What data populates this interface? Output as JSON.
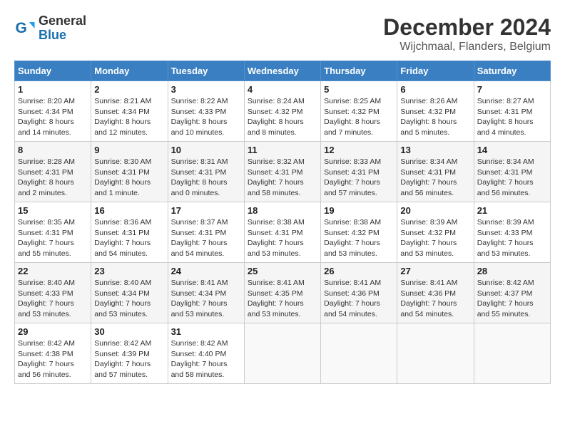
{
  "logo": {
    "line1": "General",
    "line2": "Blue"
  },
  "header": {
    "month": "December 2024",
    "location": "Wijchmaal, Flanders, Belgium"
  },
  "weekdays": [
    "Sunday",
    "Monday",
    "Tuesday",
    "Wednesday",
    "Thursday",
    "Friday",
    "Saturday"
  ],
  "weeks": [
    [
      {
        "day": "1",
        "sunrise": "Sunrise: 8:20 AM",
        "sunset": "Sunset: 4:34 PM",
        "daylight": "Daylight: 8 hours and 14 minutes."
      },
      {
        "day": "2",
        "sunrise": "Sunrise: 8:21 AM",
        "sunset": "Sunset: 4:34 PM",
        "daylight": "Daylight: 8 hours and 12 minutes."
      },
      {
        "day": "3",
        "sunrise": "Sunrise: 8:22 AM",
        "sunset": "Sunset: 4:33 PM",
        "daylight": "Daylight: 8 hours and 10 minutes."
      },
      {
        "day": "4",
        "sunrise": "Sunrise: 8:24 AM",
        "sunset": "Sunset: 4:32 PM",
        "daylight": "Daylight: 8 hours and 8 minutes."
      },
      {
        "day": "5",
        "sunrise": "Sunrise: 8:25 AM",
        "sunset": "Sunset: 4:32 PM",
        "daylight": "Daylight: 8 hours and 7 minutes."
      },
      {
        "day": "6",
        "sunrise": "Sunrise: 8:26 AM",
        "sunset": "Sunset: 4:32 PM",
        "daylight": "Daylight: 8 hours and 5 minutes."
      },
      {
        "day": "7",
        "sunrise": "Sunrise: 8:27 AM",
        "sunset": "Sunset: 4:31 PM",
        "daylight": "Daylight: 8 hours and 4 minutes."
      }
    ],
    [
      {
        "day": "8",
        "sunrise": "Sunrise: 8:28 AM",
        "sunset": "Sunset: 4:31 PM",
        "daylight": "Daylight: 8 hours and 2 minutes."
      },
      {
        "day": "9",
        "sunrise": "Sunrise: 8:30 AM",
        "sunset": "Sunset: 4:31 PM",
        "daylight": "Daylight: 8 hours and 1 minute."
      },
      {
        "day": "10",
        "sunrise": "Sunrise: 8:31 AM",
        "sunset": "Sunset: 4:31 PM",
        "daylight": "Daylight: 8 hours and 0 minutes."
      },
      {
        "day": "11",
        "sunrise": "Sunrise: 8:32 AM",
        "sunset": "Sunset: 4:31 PM",
        "daylight": "Daylight: 7 hours and 58 minutes."
      },
      {
        "day": "12",
        "sunrise": "Sunrise: 8:33 AM",
        "sunset": "Sunset: 4:31 PM",
        "daylight": "Daylight: 7 hours and 57 minutes."
      },
      {
        "day": "13",
        "sunrise": "Sunrise: 8:34 AM",
        "sunset": "Sunset: 4:31 PM",
        "daylight": "Daylight: 7 hours and 56 minutes."
      },
      {
        "day": "14",
        "sunrise": "Sunrise: 8:34 AM",
        "sunset": "Sunset: 4:31 PM",
        "daylight": "Daylight: 7 hours and 56 minutes."
      }
    ],
    [
      {
        "day": "15",
        "sunrise": "Sunrise: 8:35 AM",
        "sunset": "Sunset: 4:31 PM",
        "daylight": "Daylight: 7 hours and 55 minutes."
      },
      {
        "day": "16",
        "sunrise": "Sunrise: 8:36 AM",
        "sunset": "Sunset: 4:31 PM",
        "daylight": "Daylight: 7 hours and 54 minutes."
      },
      {
        "day": "17",
        "sunrise": "Sunrise: 8:37 AM",
        "sunset": "Sunset: 4:31 PM",
        "daylight": "Daylight: 7 hours and 54 minutes."
      },
      {
        "day": "18",
        "sunrise": "Sunrise: 8:38 AM",
        "sunset": "Sunset: 4:31 PM",
        "daylight": "Daylight: 7 hours and 53 minutes."
      },
      {
        "day": "19",
        "sunrise": "Sunrise: 8:38 AM",
        "sunset": "Sunset: 4:32 PM",
        "daylight": "Daylight: 7 hours and 53 minutes."
      },
      {
        "day": "20",
        "sunrise": "Sunrise: 8:39 AM",
        "sunset": "Sunset: 4:32 PM",
        "daylight": "Daylight: 7 hours and 53 minutes."
      },
      {
        "day": "21",
        "sunrise": "Sunrise: 8:39 AM",
        "sunset": "Sunset: 4:33 PM",
        "daylight": "Daylight: 7 hours and 53 minutes."
      }
    ],
    [
      {
        "day": "22",
        "sunrise": "Sunrise: 8:40 AM",
        "sunset": "Sunset: 4:33 PM",
        "daylight": "Daylight: 7 hours and 53 minutes."
      },
      {
        "day": "23",
        "sunrise": "Sunrise: 8:40 AM",
        "sunset": "Sunset: 4:34 PM",
        "daylight": "Daylight: 7 hours and 53 minutes."
      },
      {
        "day": "24",
        "sunrise": "Sunrise: 8:41 AM",
        "sunset": "Sunset: 4:34 PM",
        "daylight": "Daylight: 7 hours and 53 minutes."
      },
      {
        "day": "25",
        "sunrise": "Sunrise: 8:41 AM",
        "sunset": "Sunset: 4:35 PM",
        "daylight": "Daylight: 7 hours and 53 minutes."
      },
      {
        "day": "26",
        "sunrise": "Sunrise: 8:41 AM",
        "sunset": "Sunset: 4:36 PM",
        "daylight": "Daylight: 7 hours and 54 minutes."
      },
      {
        "day": "27",
        "sunrise": "Sunrise: 8:41 AM",
        "sunset": "Sunset: 4:36 PM",
        "daylight": "Daylight: 7 hours and 54 minutes."
      },
      {
        "day": "28",
        "sunrise": "Sunrise: 8:42 AM",
        "sunset": "Sunset: 4:37 PM",
        "daylight": "Daylight: 7 hours and 55 minutes."
      }
    ],
    [
      {
        "day": "29",
        "sunrise": "Sunrise: 8:42 AM",
        "sunset": "Sunset: 4:38 PM",
        "daylight": "Daylight: 7 hours and 56 minutes."
      },
      {
        "day": "30",
        "sunrise": "Sunrise: 8:42 AM",
        "sunset": "Sunset: 4:39 PM",
        "daylight": "Daylight: 7 hours and 57 minutes."
      },
      {
        "day": "31",
        "sunrise": "Sunrise: 8:42 AM",
        "sunset": "Sunset: 4:40 PM",
        "daylight": "Daylight: 7 hours and 58 minutes."
      },
      null,
      null,
      null,
      null
    ]
  ]
}
